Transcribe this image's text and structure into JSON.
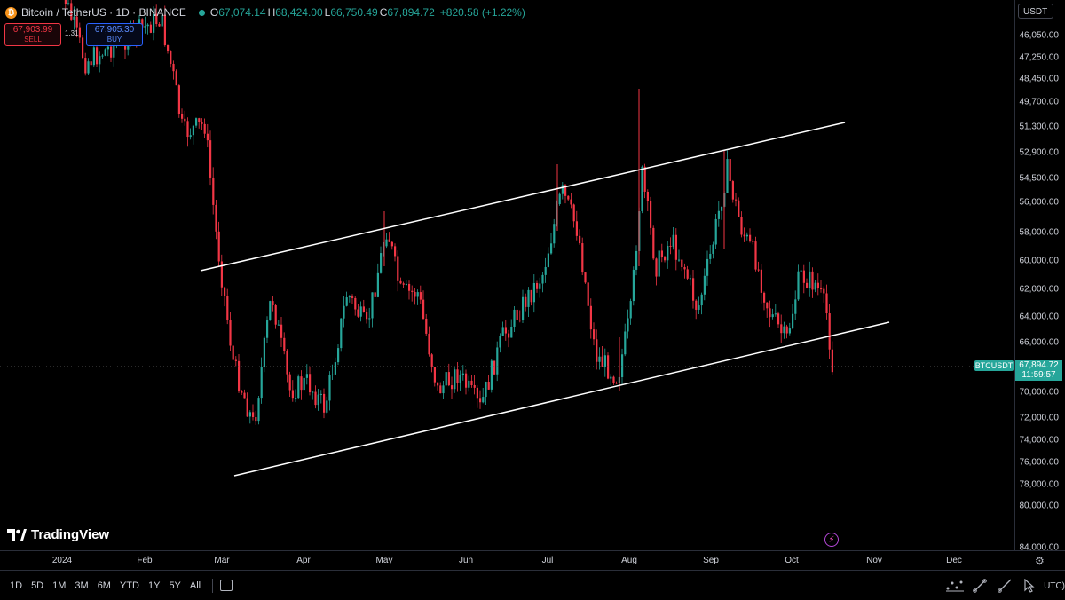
{
  "header": {
    "symbol": "Bitcoin / TetherUS · 1D · BINANCE",
    "coin_glyph": "₿",
    "open_label": "O",
    "open": "67,074.14",
    "high_label": "H",
    "high": "68,424.00",
    "low_label": "L",
    "low": "66,750.49",
    "close_label": "C",
    "close": "67,894.72",
    "change": "+820.58 (+1.22%)"
  },
  "trade": {
    "sell_price": "67,903.99",
    "sell_label": "SELL",
    "spread": "1.31",
    "buy_price": "67,905.30",
    "buy_label": "BUY"
  },
  "currency_button": "USDT",
  "last_price": {
    "ticker": "BTCUSDT",
    "price": "67,894.72",
    "countdown": "11:59:57"
  },
  "branding": "TradingView",
  "price_axis": {
    "scale": "inverted",
    "labels": [
      "46,050.00",
      "47,250.00",
      "48,450.00",
      "49,700.00",
      "51,300.00",
      "52,900.00",
      "54,500.00",
      "56,000.00",
      "58,000.00",
      "60,000.00",
      "62,000.00",
      "64,000.00",
      "66,000.00",
      "70,000.00",
      "72,000.00",
      "74,000.00",
      "76,000.00",
      "78,000.00",
      "80,000.00",
      "84,000.00"
    ]
  },
  "time_axis": {
    "labels": [
      "2024",
      "Feb",
      "Mar",
      "Apr",
      "May",
      "Jun",
      "Jul",
      "Aug",
      "Sep",
      "Oct",
      "Nov",
      "Dec"
    ]
  },
  "ranges": [
    "1D",
    "5D",
    "1M",
    "3M",
    "6M",
    "YTD",
    "1Y",
    "5Y",
    "All"
  ],
  "timezone_label": "UTC)",
  "colors": {
    "up": "#26a69a",
    "down": "#f23645",
    "background": "#000000",
    "channel_lines": "#ffffff",
    "accent": "#2962ff"
  },
  "icons": [
    "bitcoin-icon",
    "calendar-icon",
    "settings-icon",
    "lightning-icon",
    "measure-icon",
    "trendline-icon",
    "cursor-icon"
  ]
}
